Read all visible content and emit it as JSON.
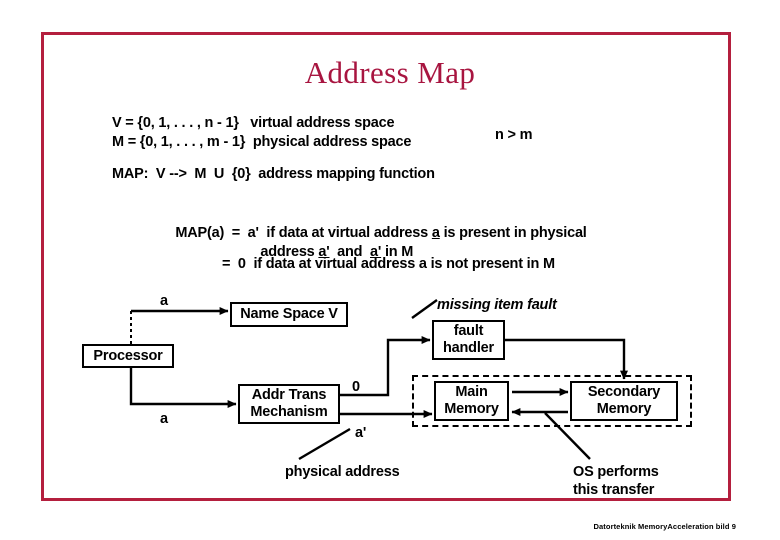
{
  "slide": {
    "title": "Address Map",
    "frame_color": "#b41f3e",
    "title_color": "#a81540",
    "footer": "Datorteknik MemoryAcceleration bild 9"
  },
  "definitions": {
    "line1": "V = {0, 1, . . . , n - 1}   virtual address space",
    "line2": "M = {0, 1, . . . , m - 1}  physical address space",
    "relation": "n > m",
    "map_line": "MAP:  V -->  M  U  {0}  address mapping function"
  },
  "mapping": {
    "line1_a": "MAP(a)  =  a'  if data at virtual address ",
    "line1_u": "a",
    "line1_b": " is present in physical",
    "line2_a": "address ",
    "line2_u1": "a'",
    "line2_b": "  and  ",
    "line2_u2": "a'",
    "line2_c": " in M",
    "line3": "=  0  if data at virtual address a is not present in M"
  },
  "diagram": {
    "boxes": {
      "processor": "Processor",
      "name_space": "Name Space V",
      "addr_trans_line1": "Addr Trans",
      "addr_trans_line2": "Mechanism",
      "fault_handler_line1": "fault",
      "fault_handler_line2": "handler",
      "main_memory_line1": "Main",
      "main_memory_line2": "Memory",
      "secondary_memory_line1": "Secondary",
      "secondary_memory_line2": "Memory"
    },
    "labels": {
      "a_top": "a",
      "a_bottom": "a",
      "zero": "0",
      "a_prime": "a'",
      "missing_item_fault": "missing item fault",
      "physical_address": "physical address",
      "os_transfer_line1": "OS performs",
      "os_transfer_line2": "this transfer"
    }
  }
}
